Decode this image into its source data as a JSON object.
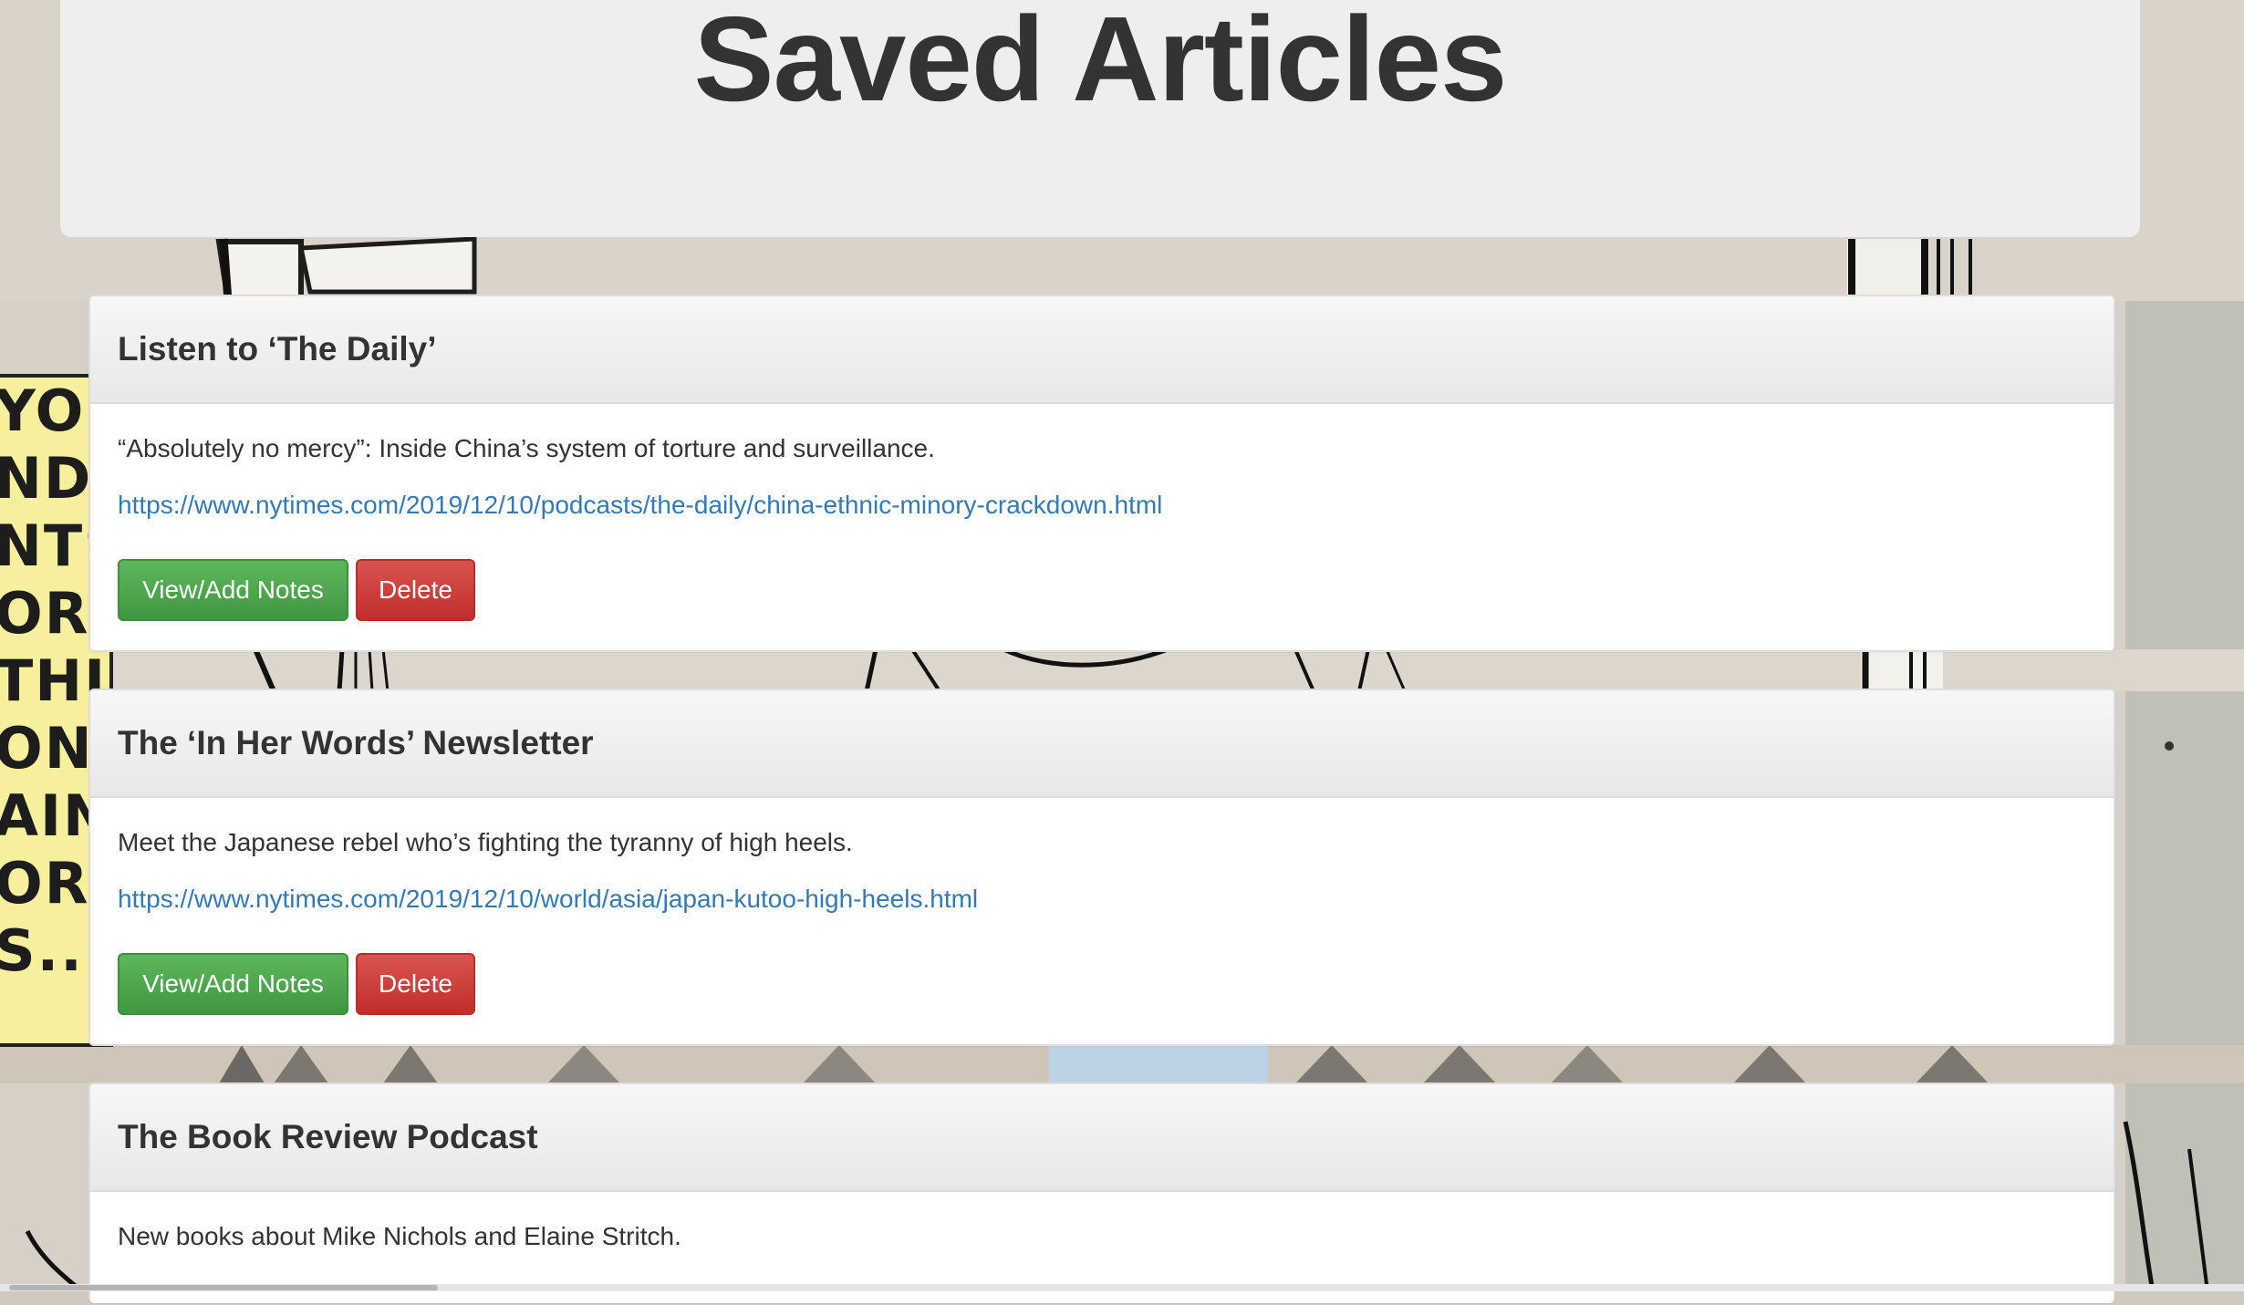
{
  "page": {
    "title": "Saved Articles"
  },
  "background": {
    "panel_lines": [
      "YOF",
      "NDE",
      "NTS",
      "ORIES",
      "THI",
      "OND",
      "AINT",
      "ORIA",
      "S..."
    ]
  },
  "articles": [
    {
      "headline": "Listen to ‘The Daily’",
      "summary": "“Absolutely no mercy”: Inside China’s system of torture and surveillance.",
      "url": "https://www.nytimes.com/2019/12/10/podcasts/the-daily/china-ethnic-minory-crackdown.html",
      "notes_label": "View/Add Notes",
      "delete_label": "Delete"
    },
    {
      "headline": "The ‘In Her Words’ Newsletter",
      "summary": "Meet the Japanese rebel who’s fighting the tyranny of high heels.",
      "url": "https://www.nytimes.com/2019/12/10/world/asia/japan-kutoo-high-heels.html",
      "notes_label": "View/Add Notes",
      "delete_label": "Delete"
    },
    {
      "headline": "The Book Review Podcast",
      "summary": "New books about Mike Nichols and Elaine Stritch."
    }
  ],
  "colors": {
    "link": "#337ab7",
    "success": "#5cb85c",
    "danger": "#d9534f",
    "jumbotron_bg": "#eeeeee",
    "panel_yellow": "#f6ef9c"
  }
}
